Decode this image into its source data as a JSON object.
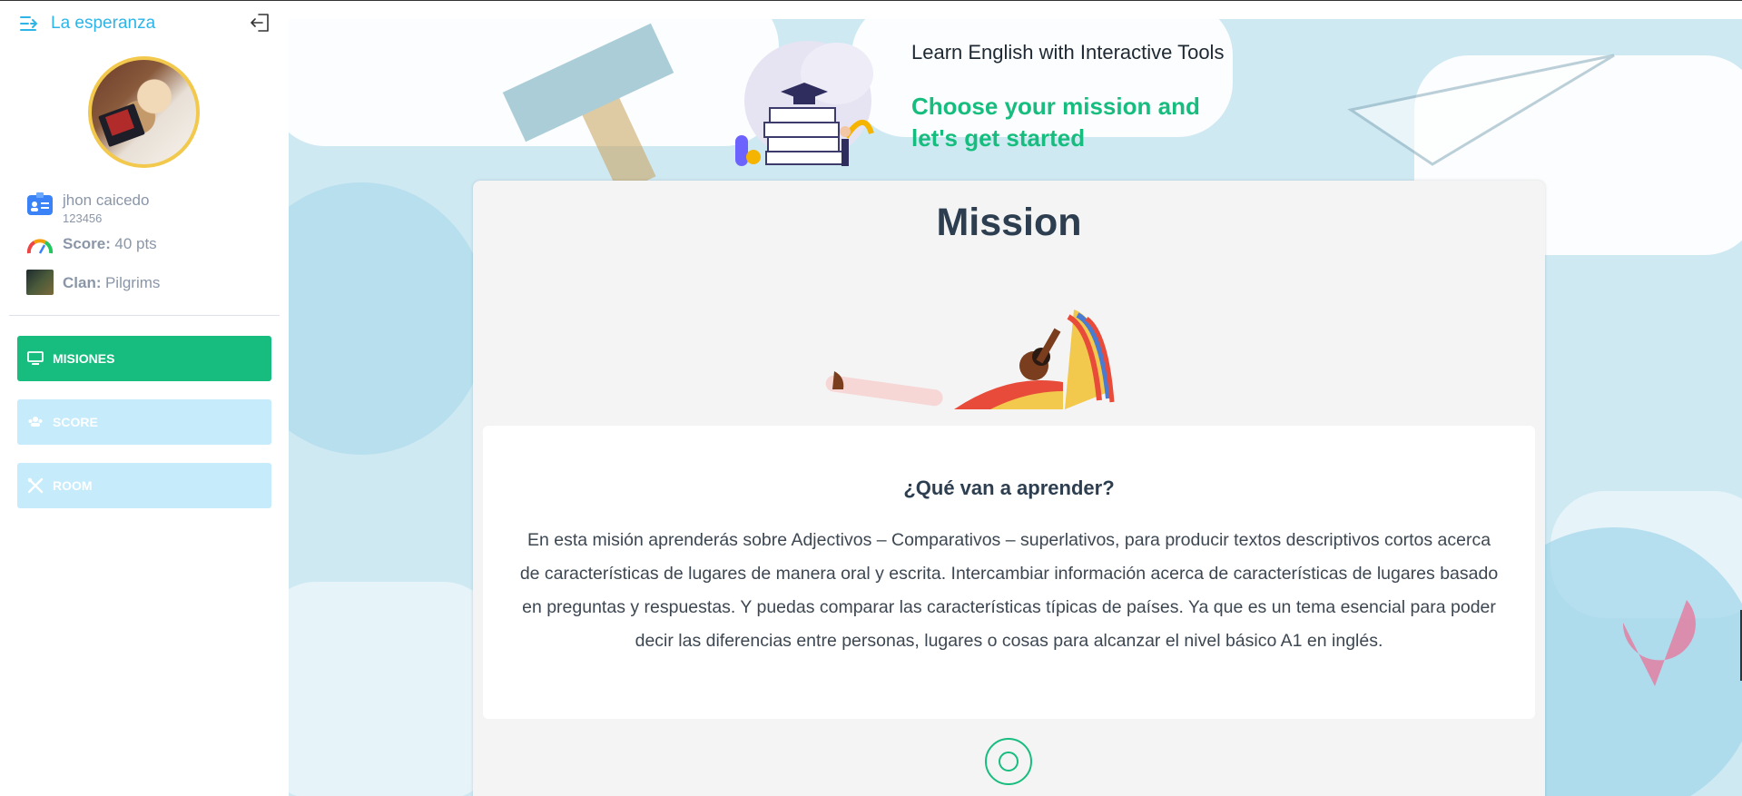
{
  "sidebar": {
    "brand": "La esperanza",
    "user": {
      "name": "jhon caicedo",
      "id": "123456"
    },
    "score": {
      "label": "Score:",
      "value": "40 pts"
    },
    "clan": {
      "label": "Clan:",
      "value": "Pilgrims"
    },
    "nav": [
      {
        "label": "MISIONES",
        "icon": "monitor-icon",
        "active": true
      },
      {
        "label": "SCORE",
        "icon": "group-icon",
        "active": false
      },
      {
        "label": "ROOM",
        "icon": "tools-icon",
        "active": false
      }
    ]
  },
  "header": {
    "title": "Learn English with Interactive Tools",
    "subtitle": "Choose your mission and let's get started"
  },
  "mission": {
    "title": "Mission",
    "learn_title": "¿Qué van a aprender?",
    "learn_text": "En esta misión aprenderás sobre Adjectivos – Comparativos – superlativos, para producir textos descriptivos cortos acerca de características de lugares de manera oral y escrita. Intercambiar información acerca de características de lugares basado en preguntas y respuestas. Y puedas comparar las características típicas de países. Ya que es un tema esencial para poder decir las diferencias entre personas, lugares o cosas para alcanzar el nivel básico A1 en inglés."
  },
  "colors": {
    "accent": "#17bd7e",
    "brand": "#2eb5e8",
    "inactive_nav": "#c6ebfb"
  }
}
